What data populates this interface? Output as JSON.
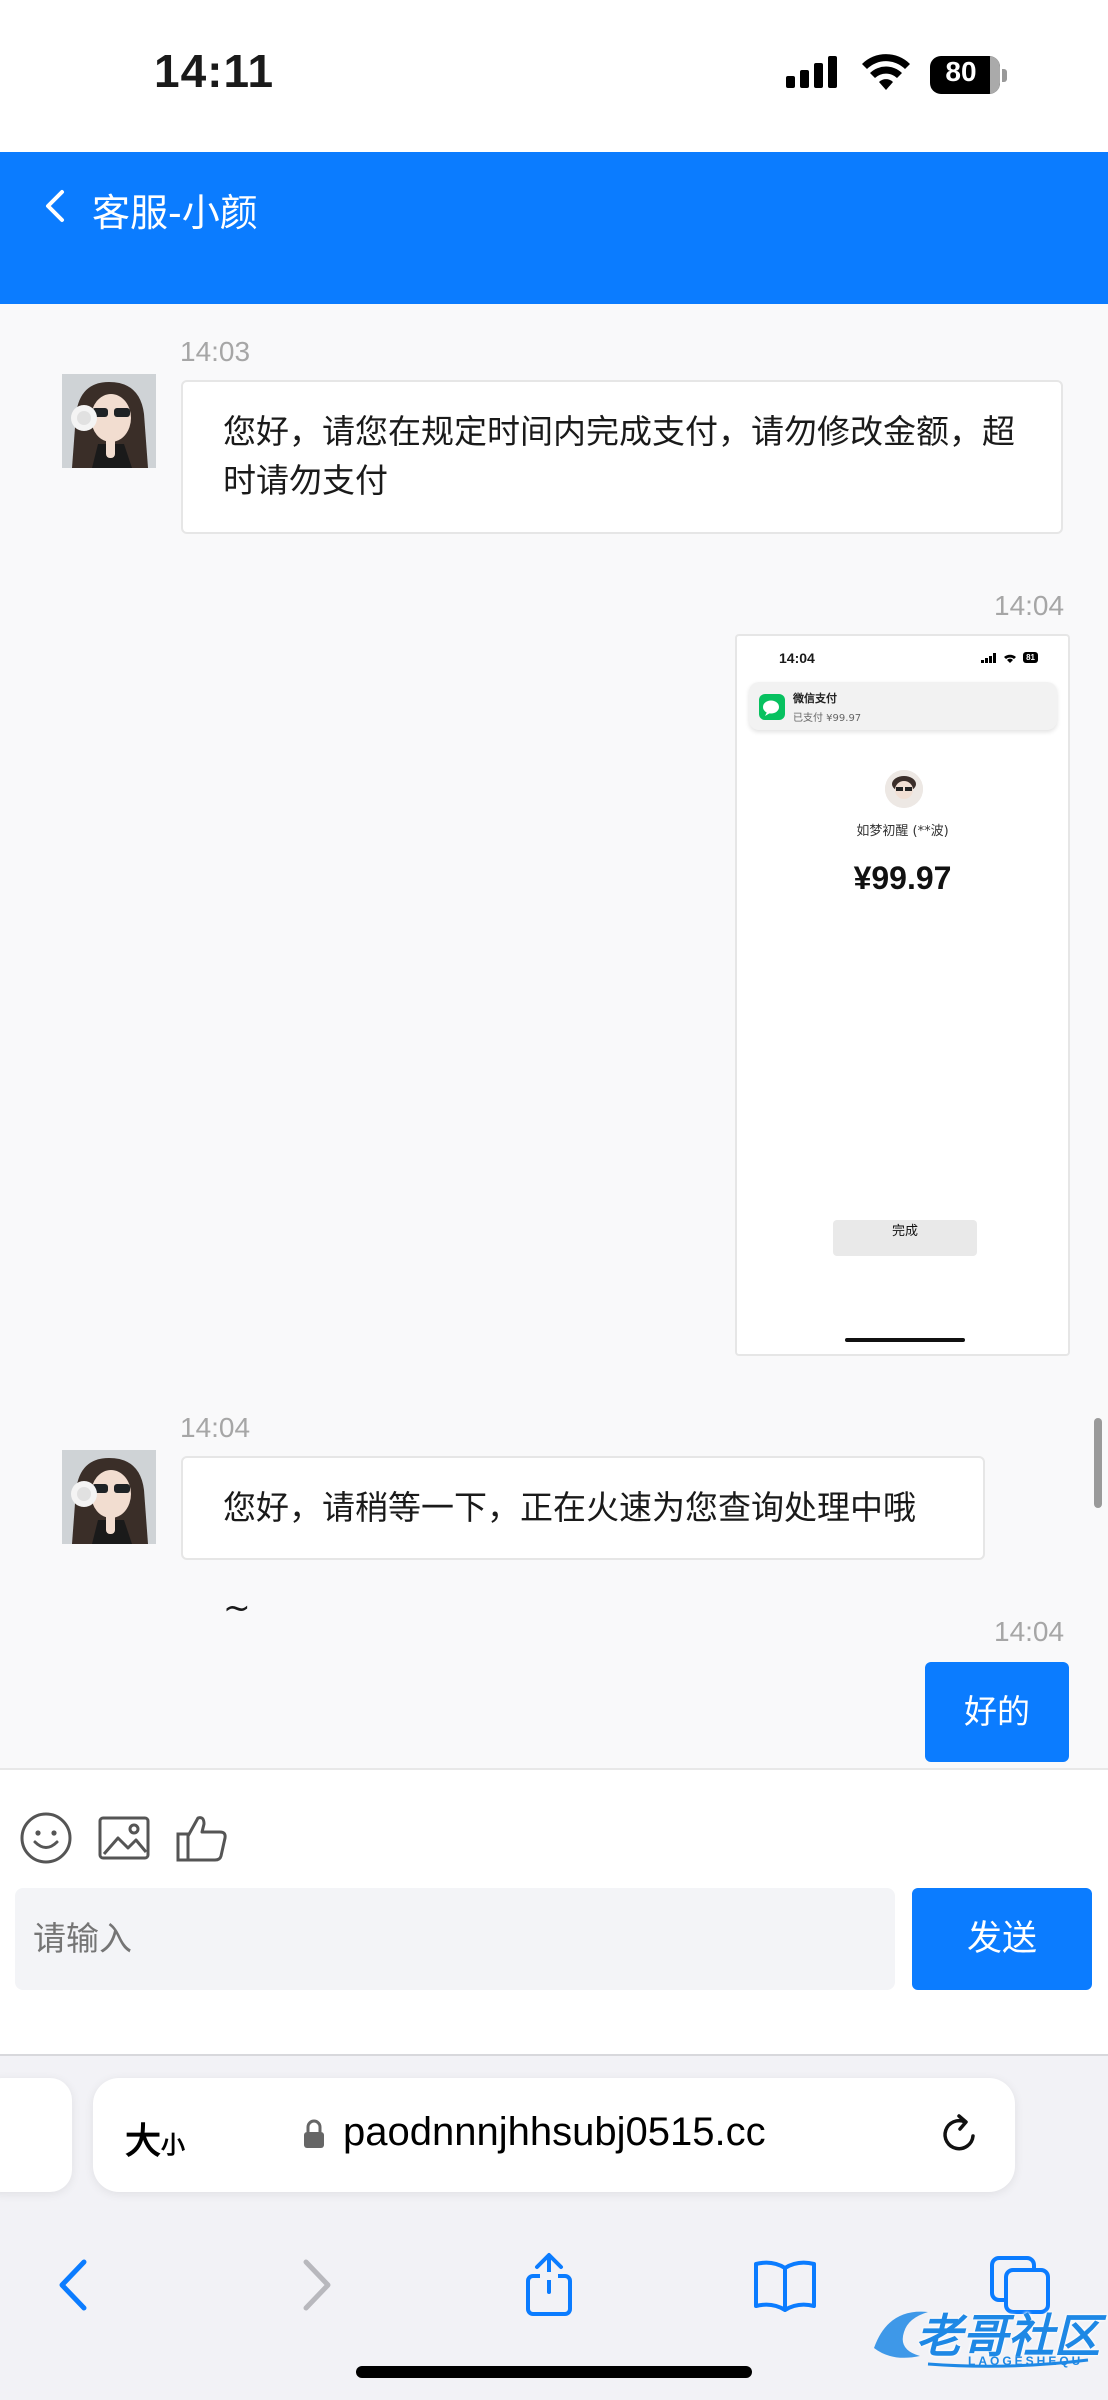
{
  "status_bar": {
    "time": "14:11",
    "battery": "80"
  },
  "header": {
    "title": "客服-小颜"
  },
  "messages": [
    {
      "side": "in",
      "time": "14:03",
      "text": "您好，请您在规定时间内完成支付，请勿修改金额，超时请勿支付"
    },
    {
      "side": "out",
      "time": "14:04",
      "type": "image"
    },
    {
      "side": "in",
      "time": "14:04",
      "text": "您好，请稍等一下，正在火速为您查询处理中哦~"
    },
    {
      "side": "out",
      "time": "14:04",
      "text": "好的"
    }
  ],
  "payment_screenshot": {
    "time": "14:04",
    "battery": "81",
    "notification_title": "微信支付",
    "notification_text": "已支付 ¥99.97",
    "payee": "如梦初醒 (**波)",
    "amount": "¥99.97",
    "done_label": "完成"
  },
  "composer": {
    "placeholder": "请输入",
    "send_label": "发送",
    "tools": [
      "emoji-icon",
      "image-icon",
      "thumbs-up-icon"
    ]
  },
  "browser": {
    "text_size_label": "大",
    "text_size_small": "小",
    "url": "paodnnnjhhsubj0515.cc"
  },
  "watermark": {
    "text": "老哥社区",
    "sub": "LAOGESHEQU"
  },
  "colors": {
    "accent": "#0b7cff",
    "wechat_green": "#07c160"
  }
}
